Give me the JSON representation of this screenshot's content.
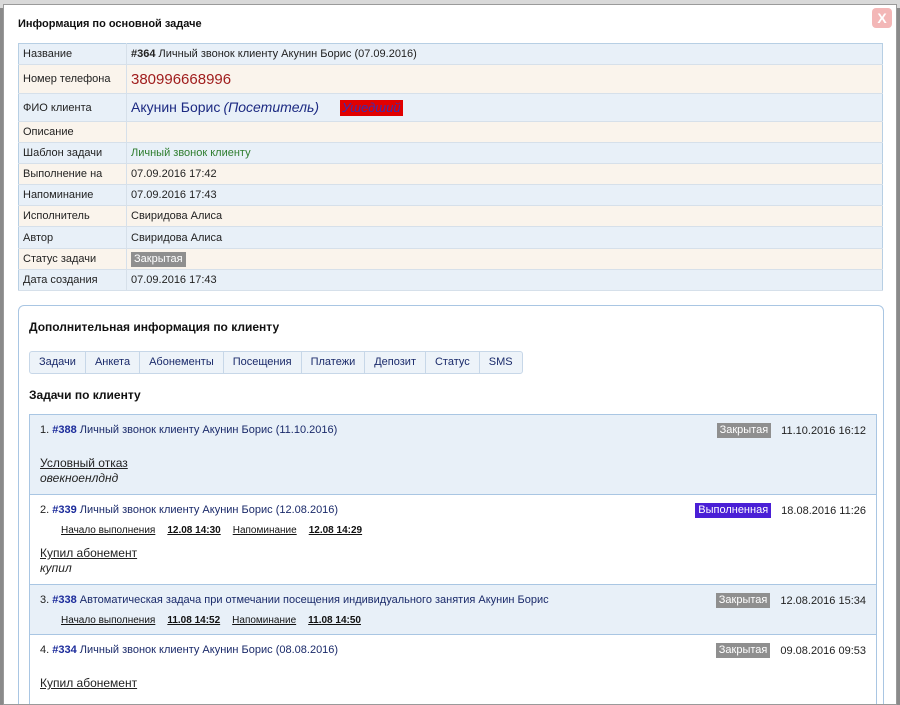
{
  "modal": {
    "title": "Информация по основной задаче",
    "close_label": "X"
  },
  "main_task": {
    "rows": [
      {
        "label": "Название",
        "id": "#364",
        "value": "Личный звонок клиенту Акунин Борис (07.09.2016)"
      },
      {
        "label": "Номер телефона",
        "value": "380996668996"
      },
      {
        "label": "ФИО клиента",
        "name": "Акунин Борис",
        "role": "(Посетитель)",
        "tag": "Ушедший"
      },
      {
        "label": "Описание",
        "value": ""
      },
      {
        "label": "Шаблон задачи",
        "value": "Личный звонок клиенту"
      },
      {
        "label": "Выполнение на",
        "value": "07.09.2016 17:42"
      },
      {
        "label": "Напоминание",
        "value": "07.09.2016 17:43"
      },
      {
        "label": "Исполнитель",
        "value": "Свиридова Алиса"
      },
      {
        "label": "Автор",
        "value": "Свиридова Алиса"
      },
      {
        "label": "Статус задачи",
        "value": "Закрытая"
      },
      {
        "label": "Дата создания",
        "value": "07.09.2016 17:43"
      }
    ]
  },
  "client_info": {
    "title": "Дополнительная информация по клиенту",
    "tabs": [
      "Задачи",
      "Анкета",
      "Абонементы",
      "Посещения",
      "Платежи",
      "Депозит",
      "Статус",
      "SMS"
    ],
    "section_title": "Задачи по клиенту",
    "meta_labels": {
      "start": "Начало выполнения",
      "reminder": "Напоминание"
    },
    "tasks": [
      {
        "num": "1.",
        "id": "#388",
        "title": "Личный звонок клиенту Акунин Борис (11.10.2016)",
        "status": "Закрытая",
        "status_color": "#8f8f8f",
        "date": "11.10.2016 16:12",
        "result": "Условный отказ",
        "comment": "овекноенлднд"
      },
      {
        "num": "2.",
        "id": "#339",
        "title": "Личный звонок клиенту Акунин Борис (12.08.2016)",
        "status": "Выполненная",
        "status_color": "#4a1fd6",
        "date": "18.08.2016 11:26",
        "start": "12.08 14:30",
        "reminder": "12.08 14:29",
        "result": "Купил абонемент",
        "comment": "купил"
      },
      {
        "num": "3.",
        "id": "#338",
        "title": "Автоматическая задача при отмечании посещения индивидуального занятия Акунин Борис",
        "status": "Закрытая",
        "status_color": "#8f8f8f",
        "date": "12.08.2016 15:34",
        "start": "11.08 14:52",
        "reminder": "11.08 14:50"
      },
      {
        "num": "4.",
        "id": "#334",
        "title": "Личный звонок клиенту Акунин Борис (08.08.2016)",
        "status": "Закрытая",
        "status_color": "#8f8f8f",
        "date": "09.08.2016 09:53",
        "result": "Купил абонемент"
      }
    ]
  }
}
